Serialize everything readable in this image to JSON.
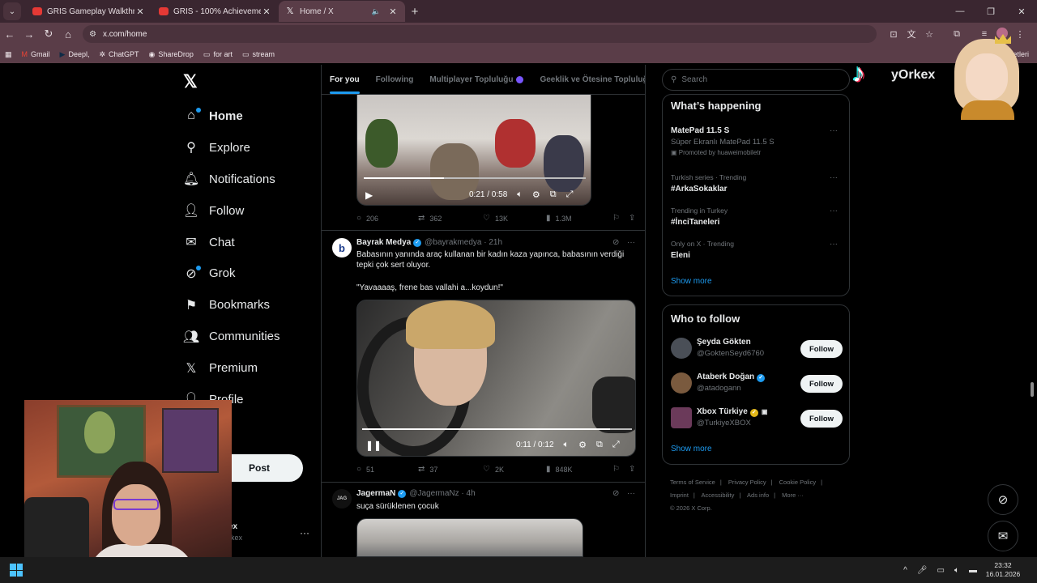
{
  "browser": {
    "tabs": [
      {
        "title": "GRIS Gameplay Walkthrough P...",
        "favicon": "youtube-icon",
        "active": false
      },
      {
        "title": "GRIS - 100% Achievement/Trop...",
        "favicon": "youtube-icon",
        "active": false
      },
      {
        "title": "Home / X",
        "favicon": "x-icon",
        "active": true
      }
    ],
    "url": "x.com/home",
    "bookmarks": [
      {
        "label": "Gmail",
        "icon": "gmail-icon"
      },
      {
        "label": "Deepl,",
        "icon": "deepl-icon"
      },
      {
        "label": "ChatGPT",
        "icon": "chatgpt-icon"
      },
      {
        "label": "ShareDrop",
        "icon": "sharedrop-icon"
      },
      {
        "label": "for art",
        "icon": "folder-icon"
      },
      {
        "label": "stream",
        "icon": "folder-icon"
      }
    ],
    "bookmarks_right": "etleri"
  },
  "nav": {
    "items": [
      {
        "label": "Home",
        "icon": "home-icon"
      },
      {
        "label": "Explore",
        "icon": "search-icon"
      },
      {
        "label": "Notifications",
        "icon": "bell-icon"
      },
      {
        "label": "Follow",
        "icon": "person-add-icon"
      },
      {
        "label": "Chat",
        "icon": "mail-icon"
      },
      {
        "label": "Grok",
        "icon": "grok-icon"
      },
      {
        "label": "Bookmarks",
        "icon": "bookmark-icon"
      },
      {
        "label": "Communities",
        "icon": "people-icon"
      },
      {
        "label": "Premium",
        "icon": "x-icon"
      },
      {
        "label": "Profile",
        "icon": "person-icon"
      },
      {
        "label": "e",
        "icon": "more-icon"
      }
    ],
    "post_label": "Post",
    "account_name": "ex",
    "account_handle": "rkex"
  },
  "feed": {
    "tabs": [
      "For you",
      "Following",
      "Multiplayer Topluluğu",
      "Geeklik ve Ötesine Topluluğu"
    ],
    "tweet1": {
      "video_time": "0:21 / 0:58",
      "video_progress": 0.36,
      "replies": "206",
      "reposts": "362",
      "likes": "13K",
      "views": "1.3M"
    },
    "tweet2": {
      "name": "Bayrak Medya",
      "handle": "@bayrakmedya · 21h",
      "text1": "Babasının yanında araç kullanan bir kadın kaza yapınca, babasının verdiği tepki çok sert oluyor.",
      "text2": "\"Yavaaaaş, frene bas vallahi a...koydun!\"",
      "video_time": "0:11 / 0:12",
      "video_progress": 0.92,
      "replies": "51",
      "reposts": "37",
      "likes": "2K",
      "views": "848K"
    },
    "tweet3": {
      "name": "JagermaN",
      "handle": "@JagermaNz · 4h",
      "text": "suça sürüklenen çocuk"
    }
  },
  "sidebar": {
    "search_placeholder": "Search",
    "happening_title": "What’s happening",
    "trends": [
      {
        "meta": "",
        "name": "MatePad 11.5 S",
        "sub": "Süper Ekranlı MatePad 11.5 S",
        "promo": "Promoted by huaweimobiletr"
      },
      {
        "meta": "Turkish series · Trending",
        "name": "#ArkaSokaklar"
      },
      {
        "meta": "Trending in Turkey",
        "name": "#İnciTaneleri"
      },
      {
        "meta": "Only on X · Trending",
        "name": "Eleni"
      }
    ],
    "show_more": "Show more",
    "wtf_title": "Who to follow",
    "who_to_follow": [
      {
        "name": "Şeyda Gökten",
        "handle": "@GoktenSeyd6760",
        "verified": false
      },
      {
        "name": "Ataberk Doğan",
        "handle": "@atadogann",
        "verified": true
      },
      {
        "name": "Xbox Türkiye",
        "handle": "@TurkiyeXBOX",
        "verified": true
      }
    ],
    "follow_label": "Follow",
    "footer": [
      "Terms of Service",
      "|",
      "Privacy Policy",
      "|",
      "Cookie Policy",
      "|",
      "Imprint",
      "|",
      "Accessibility",
      "|",
      "Ads info",
      "|",
      "More ···",
      "© 2026 X Corp."
    ]
  },
  "overlay": {
    "streamer_name": "yOrkex"
  },
  "taskbar": {
    "time": "23:32",
    "date": "16.01.2026"
  },
  "colors": {
    "accent": "#1d9bf0",
    "chrome_tabbar": "#3a2630",
    "chrome_toolbar": "#5a3d48"
  }
}
